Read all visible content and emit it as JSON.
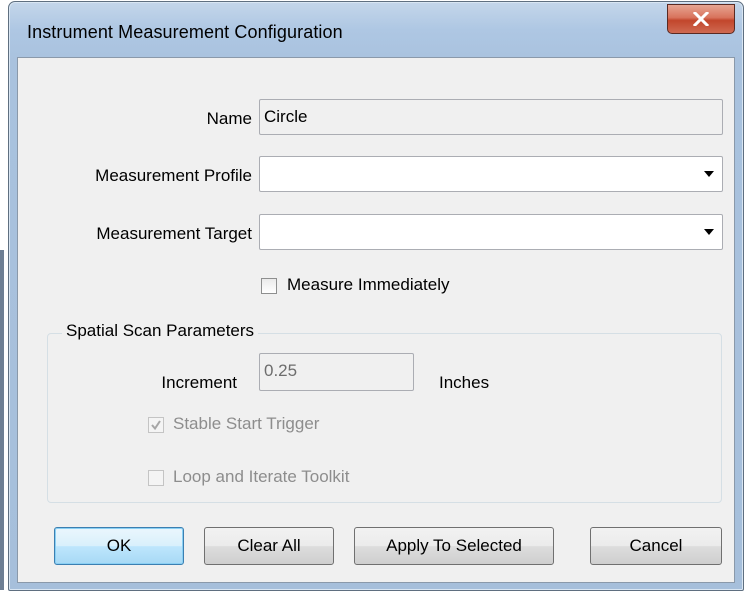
{
  "window": {
    "title": "Instrument Measurement Configuration",
    "close_icon": "close-icon"
  },
  "form": {
    "name_label": "Name",
    "name_value": "Circle",
    "profile_label": "Measurement Profile",
    "profile_value": "",
    "target_label": "Measurement Target",
    "target_value": "",
    "measure_immediately_label": "Measure Immediately",
    "measure_immediately_checked": false
  },
  "spatial_scan": {
    "group_title": "Spatial Scan Parameters",
    "increment_label": "Increment",
    "increment_value": "0.25",
    "increment_unit": "Inches",
    "stable_start_label": "Stable Start Trigger",
    "stable_start_checked": true,
    "loop_label": "Loop and Iterate Toolkit",
    "loop_checked": false
  },
  "buttons": {
    "ok": "OK",
    "clear_all": "Clear All",
    "apply_selected": "Apply To Selected",
    "cancel": "Cancel"
  },
  "colors": {
    "title_bar": "#aec7e3",
    "close_button": "#c2462c",
    "dialog_bg": "#f0f0f0",
    "default_button": "#bee6fd"
  }
}
